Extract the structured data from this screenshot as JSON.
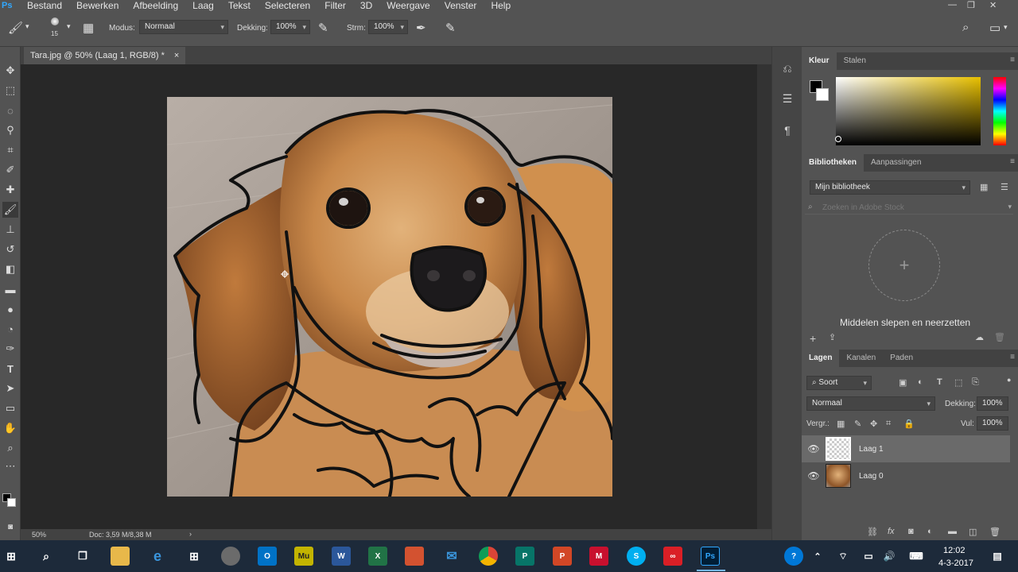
{
  "app": {
    "logo": "Ps",
    "menus": [
      "Bestand",
      "Bewerken",
      "Afbeelding",
      "Laag",
      "Tekst",
      "Selecteren",
      "Filter",
      "3D",
      "Weergave",
      "Venster",
      "Help"
    ],
    "window_controls": [
      "—",
      "❐",
      "✕"
    ]
  },
  "options": {
    "brush_size": "15",
    "mode_label": "Modus:",
    "mode_value": "Normaal",
    "opacity_label": "Dekking:",
    "opacity_value": "100%",
    "flow_label": "Strm:",
    "flow_value": "100%"
  },
  "document": {
    "tab_title": "Tara.jpg @ 50% (Laag 1, RGB/8) *",
    "close": "×",
    "zoom": "50%",
    "doc_info": "Doc: 3,59 M/8,38 M"
  },
  "panels": {
    "color": {
      "tabs": [
        "Kleur",
        "Stalen"
      ],
      "foreground": "#000000",
      "background": "#ffffff"
    },
    "libraries": {
      "tabs": [
        "Bibliotheken",
        "Aanpassingen"
      ],
      "library": "Mijn bibliotheek",
      "search_placeholder": "Zoeken in Adobe Stock",
      "drop_text": "Middelen slepen en neerzetten"
    },
    "layers": {
      "tabs": [
        "Lagen",
        "Kanalen",
        "Paden"
      ],
      "filter": "Soort",
      "blend_mode": "Normaal",
      "opacity_label": "Dekking:",
      "opacity_value": "100%",
      "lock_label": "Vergr.:",
      "fill_label": "Vul:",
      "fill_value": "100%",
      "items": [
        {
          "name": "Laag 1",
          "selected": true
        },
        {
          "name": "Laag 0",
          "selected": false
        }
      ]
    }
  },
  "taskbar": {
    "time": "12:02",
    "date": "4-3-2017"
  },
  "colors": {
    "ui_dark": "#535353",
    "canvas_bg": "#282828",
    "accent": "#31a8ff"
  }
}
